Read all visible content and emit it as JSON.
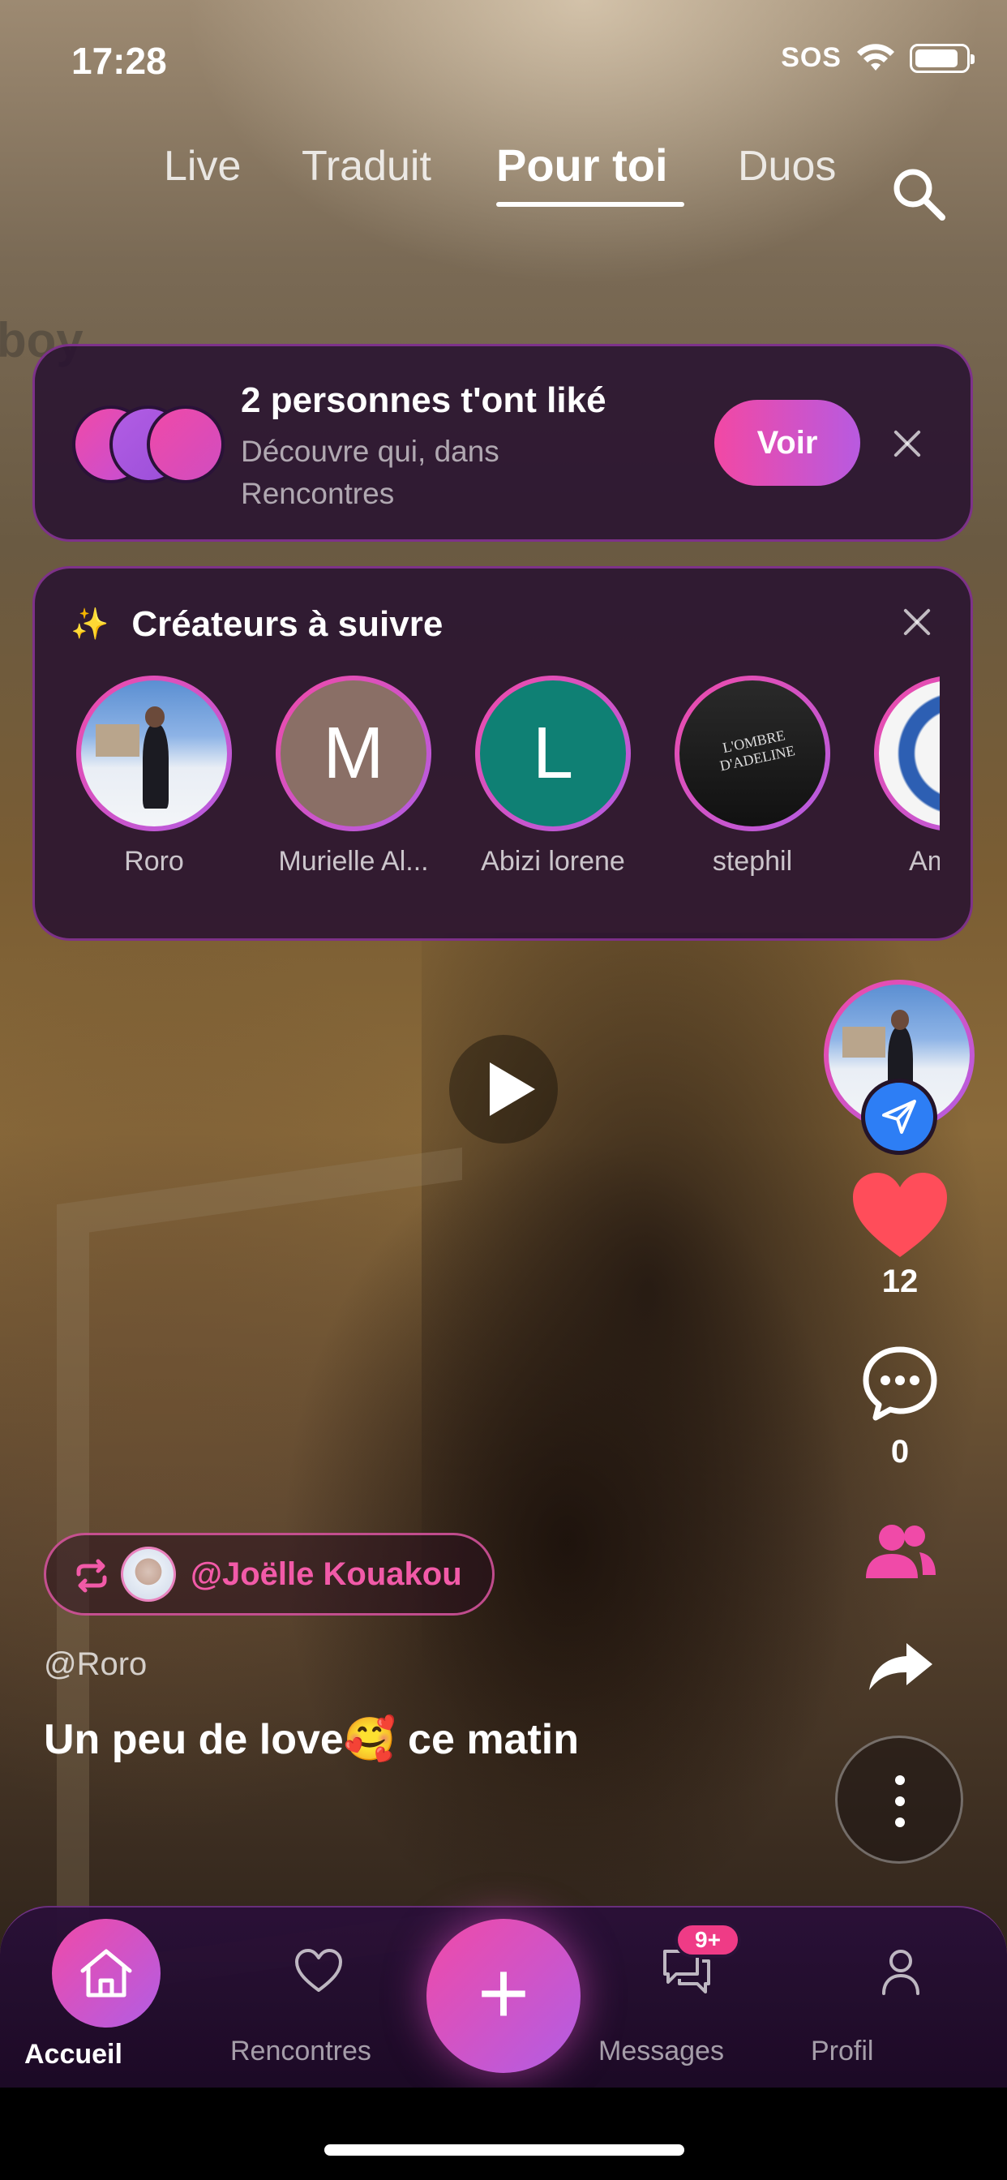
{
  "status_bar": {
    "time": "17:28",
    "carrier": "SOS"
  },
  "tabs": [
    {
      "label": "Live",
      "active": false
    },
    {
      "label": "Traduit",
      "active": false
    },
    {
      "label": "Pour toi",
      "active": true
    },
    {
      "label": "Duos",
      "active": false
    }
  ],
  "like_banner": {
    "title": "2 personnes t'ont liké",
    "subtitle": "Découvre qui, dans Rencontres",
    "button": "Voir",
    "circle_colors": [
      "#f04aa8",
      "#b25de4",
      "#e24aa0"
    ]
  },
  "creators": {
    "title": "Créateurs à suivre",
    "items": [
      {
        "name": "Roro",
        "avatar": "photo"
      },
      {
        "name": "Murielle Al...",
        "avatar": "letter",
        "letter": "M",
        "color": "#8a6f66"
      },
      {
        "name": "Abizi lorene",
        "avatar": "letter",
        "letter": "L",
        "color": "#0f8074"
      },
      {
        "name": "stephil",
        "avatar": "book",
        "book_title": "L'OMBRE D'ADELINE"
      },
      {
        "name": "Amaye",
        "avatar": "badge"
      }
    ]
  },
  "actions": {
    "likes": "12",
    "comments": "0"
  },
  "post": {
    "repost_by": "@Joëlle Kouakou",
    "username": "@Roro",
    "caption": "Un peu de love🥰  ce matin"
  },
  "nav": {
    "items": [
      {
        "label": "Accueil",
        "active": true
      },
      {
        "label": "Rencontres",
        "active": false
      },
      {
        "label": "Messages",
        "active": false
      },
      {
        "label": "Profil",
        "active": false
      }
    ],
    "messages_badge": "9+"
  },
  "colors": {
    "accent_pink": "#f04aa8",
    "accent_purple": "#b25de4",
    "like_red": "#ff4d5a"
  }
}
